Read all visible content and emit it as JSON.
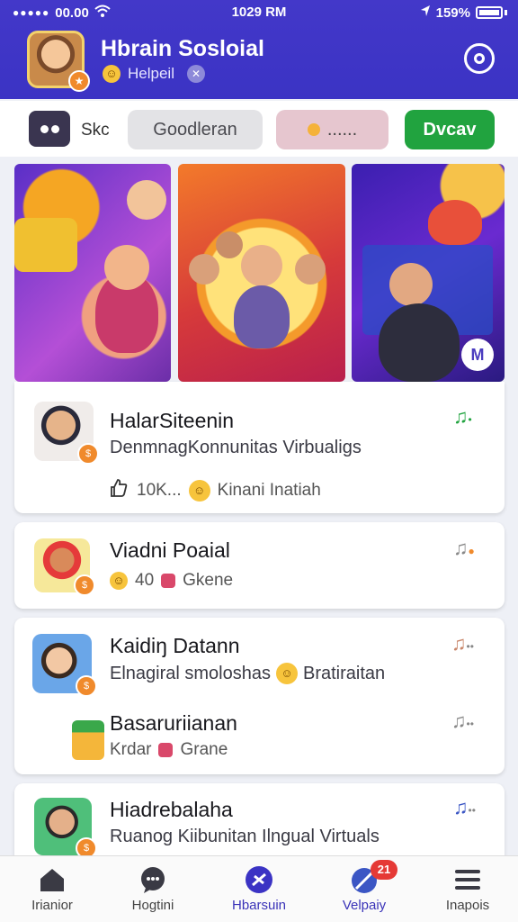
{
  "status_bar": {
    "carrier": "00.00",
    "time": "1029 RM",
    "battery": "159%"
  },
  "header": {
    "title": "Hbrain Sosloial",
    "subtitle": "Helpeil"
  },
  "filters": {
    "icon_label": "Skc",
    "chip1": "Goodleran",
    "chip2": "......",
    "chip3": "Dvcav"
  },
  "banners": [
    {
      "name": "banner-cartoon-party"
    },
    {
      "name": "banner-group-cheer"
    },
    {
      "name": "banner-guitar-player",
      "badge": "M"
    }
  ],
  "posts": [
    {
      "title": "HalarSiteenin",
      "subtitle": "DenmnagKonnunitas Virbualigs",
      "meta1": "10K...",
      "meta2": "Kinani Inatiah"
    },
    {
      "title": "Viadni Poaial",
      "meta1": "40",
      "meta2": "Gkene"
    },
    {
      "title": "Kaidiŋ Datann",
      "subtitle": "Elnagiral smoloshas",
      "subtitle2": "Bratiraitan"
    },
    {
      "title": "Basaruriianan",
      "meta1": "Krdar",
      "meta2": "Grane"
    },
    {
      "title": "Hiadrebalaha",
      "subtitle": "Ruanog Kiibunitan Ilngual Virtuals"
    }
  ],
  "nav": {
    "items": [
      {
        "label": "Irianior"
      },
      {
        "label": "Hogtini"
      },
      {
        "label": "Hbarsuin"
      },
      {
        "label": "Velpaiy",
        "badge": "21"
      },
      {
        "label": "Inapois"
      }
    ]
  },
  "colors": {
    "header": "#3b33c4",
    "accent_green": "#21a33f",
    "accent_orange": "#f08a2c"
  }
}
